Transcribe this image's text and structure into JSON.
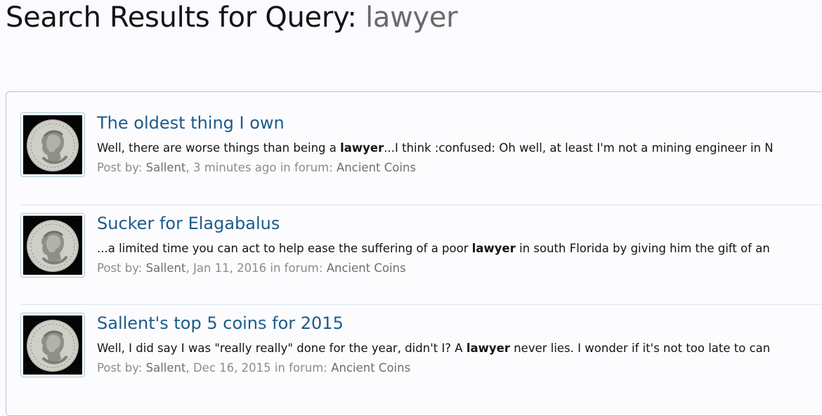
{
  "header": {
    "title_prefix": "Search Results for Query:",
    "query": "lawyer"
  },
  "results": [
    {
      "title": "The oldest thing I own",
      "snippet_before": "Well, there are worse things than being a ",
      "snippet_match": "lawyer",
      "snippet_after": "...I think :confused: Oh well, at least I'm not a mining engineer in N",
      "meta_prefix": "Post by:",
      "author": "Sallent",
      "date": "3 minutes ago",
      "forum_prefix": "in forum:",
      "forum": "Ancient Coins",
      "avatar_icon": "roman-coin-avatar-icon"
    },
    {
      "title": "Sucker for Elagabalus",
      "snippet_before": "...a limited time you can act to help ease the suffering of a poor ",
      "snippet_match": "lawyer",
      "snippet_after": " in south Florida by giving him the gift of an",
      "meta_prefix": "Post by:",
      "author": "Sallent",
      "date": "Jan 11, 2016",
      "forum_prefix": "in forum:",
      "forum": "Ancient Coins",
      "avatar_icon": "roman-coin-avatar-icon"
    },
    {
      "title": "Sallent's top 5 coins for 2015",
      "snippet_before": "Well, I did say I was \"really really\" done for the year, didn't I? A ",
      "snippet_match": "lawyer",
      "snippet_after": " never lies. I wonder if it's not too late to can",
      "meta_prefix": "Post by:",
      "author": "Sallent",
      "date": "Dec 16, 2015",
      "forum_prefix": "in forum:",
      "forum": "Ancient Coins",
      "avatar_icon": "roman-coin-avatar-icon"
    }
  ],
  "colors": {
    "link": "#1c5b89",
    "border": "#a9c8d8",
    "meta": "#8c8c8c"
  }
}
